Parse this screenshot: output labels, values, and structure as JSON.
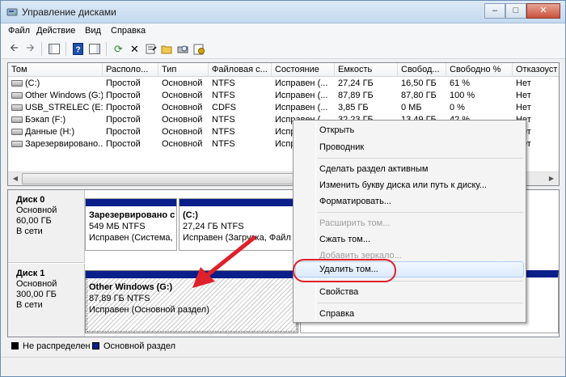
{
  "window": {
    "title": "Управление дисками"
  },
  "menu": [
    "Файл",
    "Действие",
    "Вид",
    "Справка"
  ],
  "columns": [
    "Том",
    "Располо...",
    "Тип",
    "Файловая с...",
    "Состояние",
    "Емкость",
    "Свобод...",
    "Свободно %",
    "Отказоуст"
  ],
  "volumes": [
    [
      "(C:)",
      "Простой",
      "Основной",
      "NTFS",
      "Исправен (...",
      "27,24 ГБ",
      "16,50 ГБ",
      "61 %",
      "Нет"
    ],
    [
      "Other Windows  (G:)",
      "Простой",
      "Основной",
      "NTFS",
      "Исправен (...",
      "87,89 ГБ",
      "87,80 ГБ",
      "100 %",
      "Нет"
    ],
    [
      "USB_STRELEC (E:)",
      "Простой",
      "Основной",
      "CDFS",
      "Исправен (...",
      "3,85 ГБ",
      "0 МБ",
      "0 %",
      "Нет"
    ],
    [
      "Бэкап (F:)",
      "Простой",
      "Основной",
      "NTFS",
      "Исправен (...",
      "32,23 ГБ",
      "13,49 ГБ",
      "42 %",
      "Нет"
    ],
    [
      "Данные (H:)",
      "Простой",
      "Основной",
      "NTFS",
      "Исправен (...",
      "",
      "",
      "",
      "Нет"
    ],
    [
      "Зарезервировано...",
      "Простой",
      "Основной",
      "NTFS",
      "Исправен (...",
      "",
      "",
      "",
      "Нет"
    ]
  ],
  "disks": [
    {
      "name": "Диск 0",
      "type": "Основной",
      "size": "60,00 ГБ",
      "status": "В сети",
      "partitions": [
        {
          "name": "Зарезервировано с",
          "size": "549 МБ NTFS",
          "status": "Исправен (Система,"
        },
        {
          "name": "(C:)",
          "size": "27,24 ГБ NTFS",
          "status": "Исправен (Загрузка, Файл п"
        }
      ]
    },
    {
      "name": "Диск 1",
      "type": "Основной",
      "size": "300,00 ГБ",
      "status": "В сети",
      "partitions": [
        {
          "name": "Other Windows  (G:)",
          "size": "87,89 ГБ NTFS",
          "status": "Исправен (Основной раздел)"
        }
      ]
    }
  ],
  "legend": [
    {
      "label": "Не распределен",
      "color": "#000000"
    },
    {
      "label": "Основной раздел",
      "color": "#0a1f8a"
    }
  ],
  "context_menu": {
    "items": [
      {
        "label": "Открыть",
        "enabled": true
      },
      {
        "label": "Проводник",
        "enabled": true
      },
      {
        "label": "Сделать раздел активным",
        "enabled": true
      },
      {
        "label": "Изменить букву диска или путь к диску...",
        "enabled": true
      },
      {
        "label": "Форматировать...",
        "enabled": true
      },
      {
        "label": "Расширить том...",
        "enabled": false
      },
      {
        "label": "Сжать том...",
        "enabled": true
      },
      {
        "label": "Добавить зеркало...",
        "enabled": false
      },
      {
        "label": "Удалить том...",
        "enabled": true,
        "highlighted": true
      },
      {
        "label": "Свойства",
        "enabled": true
      },
      {
        "label": "Справка",
        "enabled": true
      }
    ]
  },
  "colors": {
    "highlight_ring": "#e0202a",
    "arrow": "#e0202a",
    "partition_cap": "#0a1f8a"
  }
}
